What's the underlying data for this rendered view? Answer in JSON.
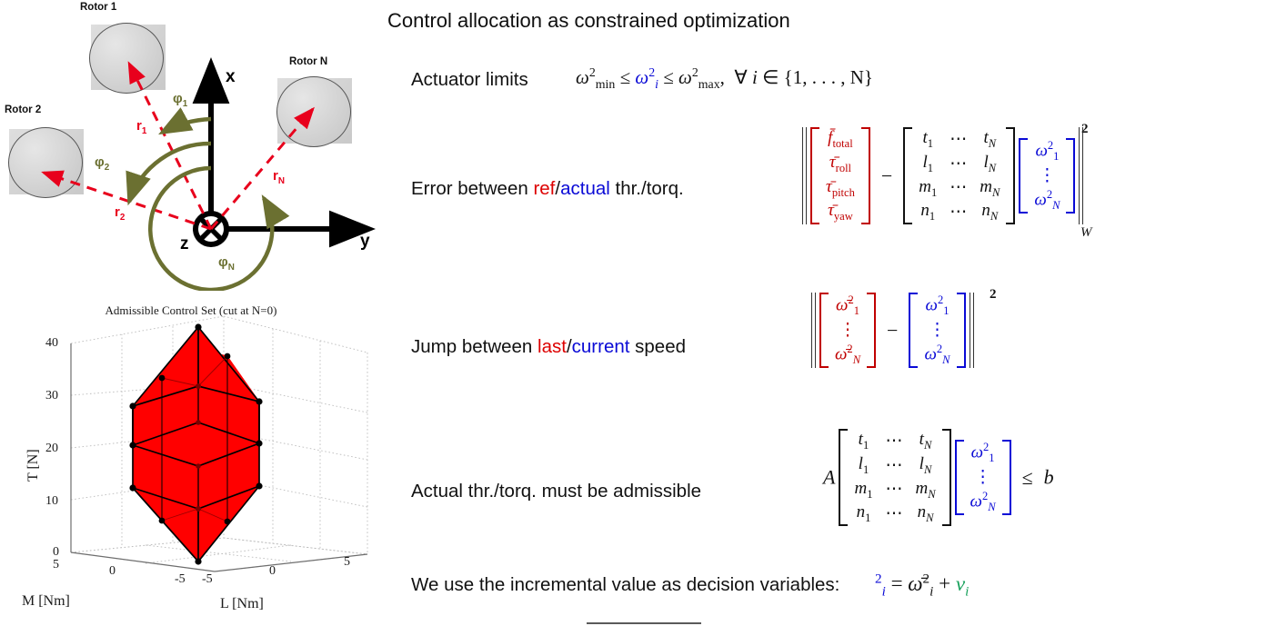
{
  "slide": {
    "title": "Control allocation as constrained optimization",
    "bottom_rule": true
  },
  "diagram": {
    "name": "rotor-geometry-diagram",
    "rotors": [
      {
        "label": "Rotor 1",
        "r_label": "r₁",
        "phi_label": "φ₁"
      },
      {
        "label": "Rotor 2",
        "r_label": "r₂",
        "phi_label": "φ₂"
      },
      {
        "label": "Rotor N",
        "r_label": "r_N",
        "phi_label": "φ_N"
      }
    ],
    "rotor1_label": "Rotor 1",
    "rotor2_label": "Rotor 2",
    "rotorN_label": "Rotor N",
    "axis_x": "x",
    "axis_y": "y",
    "axis_z": "z",
    "r1": "r",
    "r1sub": "1",
    "r2": "r",
    "r2sub": "2",
    "rN": "r",
    "rNsub": "N",
    "phi1": "φ",
    "phi1sub": "1",
    "phi2": "φ",
    "phi2sub": "2",
    "phiN": "φ",
    "phiNsub": "N",
    "colors": {
      "vector_red": "#e8001c",
      "angle_olive": "#6b7031",
      "axis_black": "#000000",
      "rotor_gray": "#cccccc"
    }
  },
  "chart_data": {
    "type": "scatter",
    "title": "Admissible Control Set (cut at N=0)",
    "xlabel": "M [Nm]",
    "ylabel": "L [Nm]",
    "zlabel": "T [N]",
    "xlim": [
      -5,
      5
    ],
    "ylim": [
      -5,
      5
    ],
    "zlim": [
      0,
      40
    ],
    "xticks": [
      "5",
      "0",
      "-5"
    ],
    "yticks": [
      "-5",
      "0",
      "5"
    ],
    "zticks": [
      "0",
      "10",
      "20",
      "30",
      "40"
    ],
    "grid": true,
    "legend": "none",
    "surface_color": "#ff0000",
    "vertex_color": "#000000",
    "description": "Red 3D convex polytope (admissible control set) plotted in M-L-T space, cut at N=0",
    "vertices": [
      {
        "M": 0,
        "L": 0,
        "T": 37
      },
      {
        "M": 0,
        "L": 0,
        "T": 0
      },
      {
        "M": -3.6,
        "L": 0,
        "T": 27
      },
      {
        "M": 3.6,
        "L": 0,
        "T": 27
      },
      {
        "M": 0,
        "L": -3.6,
        "T": 27
      },
      {
        "M": 0,
        "L": 3.6,
        "T": 27
      },
      {
        "M": -3.6,
        "L": 0,
        "T": 11
      },
      {
        "M": 3.6,
        "L": 0,
        "T": 11
      },
      {
        "M": 0,
        "L": -3.6,
        "T": 11
      },
      {
        "M": 0,
        "L": 3.6,
        "T": 11
      },
      {
        "M": -2.5,
        "L": -2.5,
        "T": 19
      },
      {
        "M": 2.5,
        "L": -2.5,
        "T": 19
      },
      {
        "M": 2.5,
        "L": 2.5,
        "T": 19
      },
      {
        "M": -2.5,
        "L": 2.5,
        "T": 19
      }
    ]
  },
  "rows": [
    {
      "id": "actuator-limits",
      "label": "Actuator limits",
      "math_plain": "ω²min ≤ ω²i ≤ ω²max, ∀ i ∈ {1,…,N}"
    },
    {
      "id": "error-ref-actual",
      "label_pre": "Error between ",
      "label_red": "ref",
      "label_slash": "/",
      "label_blue": "actual",
      "label_post": " thr./torq."
    },
    {
      "id": "jump-last-current",
      "label_pre": "Jump between ",
      "label_red": "last",
      "label_slash": "/",
      "label_blue": "current",
      "label_post": " speed"
    },
    {
      "id": "admissible",
      "label": "Actual thr./torq. must be admissible"
    },
    {
      "id": "incremental",
      "label": "We use the incremental value as decision variables:"
    }
  ],
  "math": {
    "actuator_limits": {
      "omega": "ω",
      "min": "min",
      "max": "max",
      "i": "i",
      "two": "2",
      "le": "≤",
      "comma": ",",
      "forall": "∀",
      "in": "∈",
      "set": "{1, . . . , N}"
    },
    "ref_vector": [
      "f̄ total",
      "τ̄ roll",
      "τ̄ pitch",
      "τ̄ yaw"
    ],
    "ref_vector_parts": [
      {
        "sym": "f̄",
        "sub": "total"
      },
      {
        "sym": "τ̄",
        "sub": "roll"
      },
      {
        "sym": "τ̄",
        "sub": "pitch"
      },
      {
        "sym": "τ̄",
        "sub": "yaw"
      }
    ],
    "effectiveness_matrix": [
      [
        "t₁",
        "⋯",
        "t_N"
      ],
      [
        "l₁",
        "⋯",
        "l_N"
      ],
      [
        "m₁",
        "⋯",
        "m_N"
      ],
      [
        "n₁",
        "⋯",
        "n_N"
      ]
    ],
    "effectiveness_rows": [
      {
        "first": "t",
        "dots": "⋯",
        "last": "t"
      },
      {
        "first": "l",
        "dots": "⋯",
        "last": "l"
      },
      {
        "first": "m",
        "dots": "⋯",
        "last": "m"
      },
      {
        "first": "n",
        "dots": "⋯",
        "last": "n"
      }
    ],
    "omega_vector": [
      "ω²₁",
      "⋮",
      "ω²_N"
    ],
    "omega_bar_vector": [
      "ω̄²₁",
      "⋮",
      "ω̄²_N"
    ],
    "minus": "−",
    "norm_exponent": "2",
    "norm_subscript_W": "W",
    "A": "A",
    "b": "b",
    "leq": "≤",
    "incremental_eq": "ω²ᵢ = ω̄²ᵢ + νᵢ",
    "incremental_parts": {
      "omega_i_sq": "ω",
      "equals": "=",
      "omega_bar_i_sq": "ω̄",
      "plus": "+",
      "nu": "ν",
      "i": "i",
      "two": "2"
    }
  },
  "colors": {
    "ref_red": "#dd0000",
    "actual_blue": "#0a0ad6",
    "incremental_green": "#16a05a",
    "math_red": "#c00000"
  }
}
